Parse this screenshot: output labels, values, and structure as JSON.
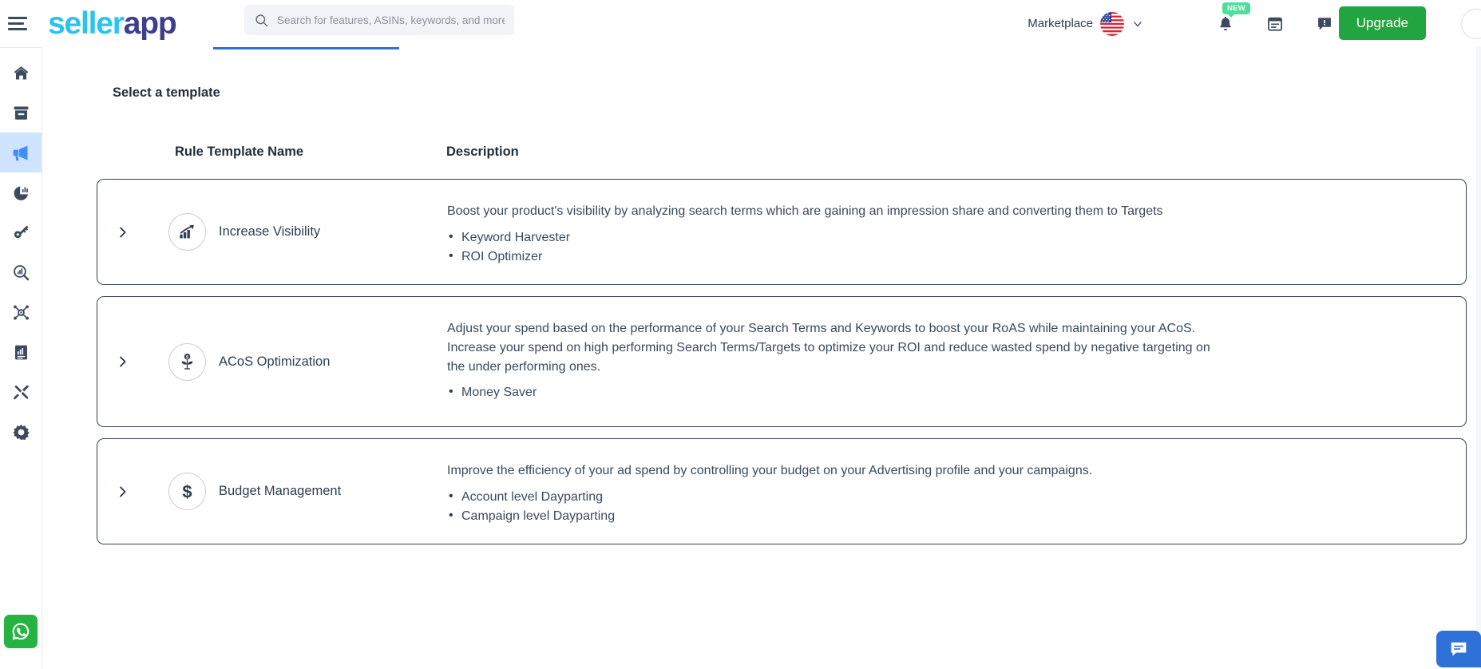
{
  "header": {
    "menu_icon": "hamburger-icon",
    "brand_part1": "seller",
    "brand_part2": "app",
    "search": {
      "placeholder": "Search for features, ASINs, keywords, and more",
      "value": "",
      "icon": "search-icon"
    },
    "marketplace_label": "Marketplace",
    "marketplace_flag": "us-flag-icon",
    "marketplace_chevron": "chevron-down-icon",
    "notification_icon": "bell-icon",
    "notification_badge": "NEW",
    "calendar_icon": "calendar-icon",
    "feedback_icon": "feedback-icon",
    "upgrade_label": "Upgrade",
    "avatar": "user-avatar"
  },
  "colors": {
    "brand_cyan": "#29c3f2",
    "brand_purple": "#3f3d8f",
    "upgrade_green": "#22a540",
    "accent_blue": "#2e71d8",
    "active_nav_bg": "#cfe4ff",
    "active_nav_fg": "#3f8efc",
    "badge_green": "#4ede9e",
    "whatsapp_green": "#25b441",
    "card_border": "#30405a",
    "text_dark": "#1f2d3d",
    "text_body": "#3a4a5e"
  },
  "sidebar": {
    "items": [
      {
        "name": "home",
        "icon": "home-icon",
        "active": false
      },
      {
        "name": "product-research",
        "icon": "archive-box-icon",
        "active": false
      },
      {
        "name": "advertising",
        "icon": "megaphone-icon",
        "active": true
      },
      {
        "name": "analytics",
        "icon": "pie-chart-icon",
        "active": false
      },
      {
        "name": "keyword-research",
        "icon": "key-icon",
        "active": false
      },
      {
        "name": "keyword-tracking",
        "icon": "magnifier-chart-icon",
        "active": false
      },
      {
        "name": "product-tracking",
        "icon": "atom-target-icon",
        "active": false
      },
      {
        "name": "reports",
        "icon": "document-chart-icon",
        "active": false
      },
      {
        "name": "tools",
        "icon": "tools-icon",
        "active": false
      },
      {
        "name": "settings",
        "icon": "gear-icon",
        "active": false
      }
    ],
    "support": {
      "name": "whatsapp-support",
      "icon": "whatsapp-icon"
    }
  },
  "main": {
    "page_title": "Select a template",
    "columns": {
      "rule_template_name": "Rule Template Name",
      "description": "Description"
    },
    "templates": [
      {
        "expand_icon": "chevron-right-icon",
        "icon": "growth-chart-arrow-icon",
        "name": "Increase Visibility",
        "description": "Boost your product's visibility by analyzing search terms which are gaining an impression share and converting them to Targets",
        "rules": [
          "Keyword Harvester",
          "ROI Optimizer"
        ]
      },
      {
        "expand_icon": "chevron-right-icon",
        "icon": "money-plant-icon",
        "name": "ACoS Optimization",
        "description": "Adjust your spend based on the performance of your Search Terms and Keywords to boost your RoAS while maintaining your ACoS. Increase your spend on high performing Search Terms/Targets to optimize your ROI and reduce wasted spend by negative targeting on the under performing ones.",
        "rules": [
          "Money Saver"
        ]
      },
      {
        "expand_icon": "chevron-right-icon",
        "icon": "dollar-sign-icon",
        "name": "Budget Management",
        "description": "Improve the efficiency of your ad spend by controlling your budget on your Advertising profile and your campaigns.",
        "rules": [
          "Account level Dayparting",
          "Campaign level Dayparting"
        ]
      }
    ],
    "chat_widget": {
      "name": "chat-support-widget",
      "icon": "chat-icon"
    }
  }
}
